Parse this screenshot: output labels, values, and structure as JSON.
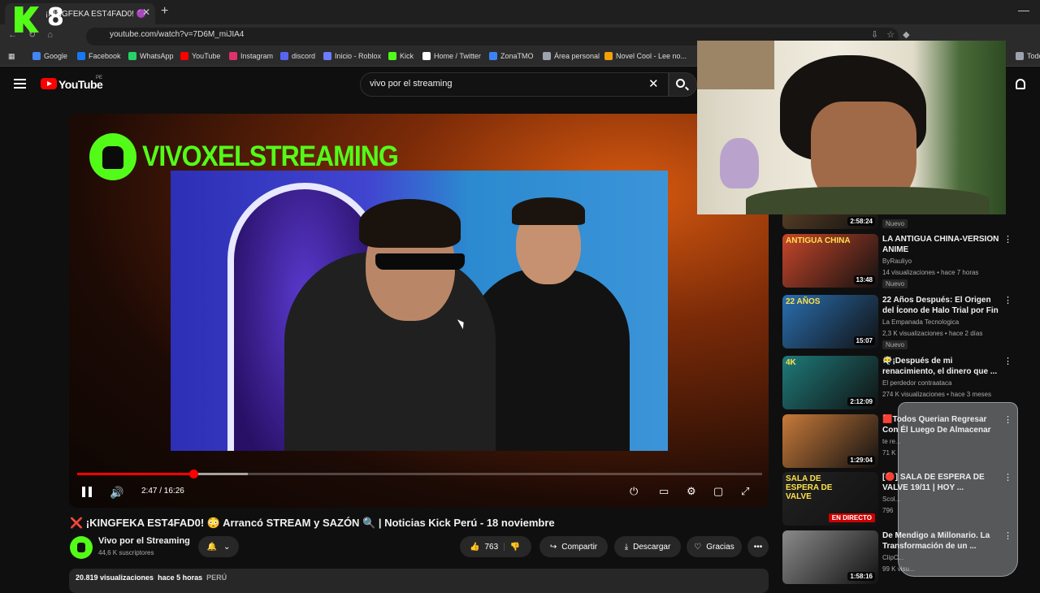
{
  "browser": {
    "tab_title": "¡KINGFEKA EST4FAD0! 🟣",
    "url": "youtube.com/watch?v=7D6M_miJIA4",
    "new_tab": "+",
    "tab_close": "✕",
    "minimize": "—",
    "kick_overlay": "8",
    "bookmarks": [
      {
        "label": "Google",
        "color": "#4285f4"
      },
      {
        "label": "Facebook",
        "color": "#1877f2"
      },
      {
        "label": "WhatsApp",
        "color": "#25d366"
      },
      {
        "label": "YouTube",
        "color": "#ff0000"
      },
      {
        "label": "Instagram",
        "color": "#e1306c"
      },
      {
        "label": "discord",
        "color": "#5865f2"
      },
      {
        "label": "Inicio - Roblox",
        "color": "#6b7cff"
      },
      {
        "label": "Kick",
        "color": "#53fc18"
      },
      {
        "label": "Home / Twitter",
        "color": "#ffffff"
      },
      {
        "label": "ZonaTMO",
        "color": "#3b82f6"
      },
      {
        "label": "Área personal",
        "color": "#9ca3af"
      },
      {
        "label": "Novel Cool - Lee no...",
        "color": "#f59e0b"
      },
      {
        "label": "Todos los",
        "color": "#9ca3af"
      }
    ]
  },
  "youtube": {
    "logo_text": "YouTube",
    "country": "PE",
    "search_query": "vivo por el streaming",
    "clear": "✕"
  },
  "player": {
    "brand": "VIVOXELSTREAMING",
    "time": "2:47 / 16:26",
    "progress_fraction": 0.17,
    "volume_icon": "🔊"
  },
  "video": {
    "title": "❌ ¡KINGFEKA EST4FAD0! 😳 Arrancó STREAM y SAZÓN 🔍 | Noticias Kick Perú - 18 noviembre",
    "channel": "Vivo por el Streaming",
    "subscribers": "44,6 K suscriptores",
    "likes": "763",
    "share": "Compartir",
    "download": "Descargar",
    "thanks": "Gracias",
    "more": "•••",
    "views": "20.819 visualizaciones",
    "age": "hace 5 horas",
    "location": "PERÚ"
  },
  "recommendations": [
    {
      "title": "",
      "channel": "",
      "meta": "",
      "badge": "Nuevo",
      "duration": "2:58:24",
      "thumb": "#6a4a2a"
    },
    {
      "title": "LA ANTIGUA CHINA-VERSION ANIME",
      "channel": "ByRauliyo",
      "meta": "14 visualizaciones • hace 7 horas",
      "badge": "Nuevo",
      "duration": "13:48",
      "thumb": "#c8462a",
      "thumb_text": "ANTIGUA CHINA"
    },
    {
      "title": "22 Años Después: El Origen del Ícono de Halo Trial por Fin ...",
      "channel": "La Empanada Tecnologica",
      "meta": "2,3 K visualizaciones • hace 2 días",
      "badge": "Nuevo",
      "duration": "15:07",
      "thumb": "#2a6fb0",
      "thumb_text": "22 AÑOS"
    },
    {
      "title": "😶‍🌫️¡Después de mi renacimiento, el dinero que ...",
      "channel": "El perdedor contraataca",
      "meta": "274 K visualizaciones • hace 3 meses",
      "badge": "",
      "duration": "2:12:09",
      "thumb": "#1e7a7a",
      "thumb_text": "4K"
    },
    {
      "title": "🟥Todos Querian Regresar Con Él Luego De Almacenar Mas D...",
      "channel": "te re...",
      "meta": "71 K",
      "badge": "",
      "duration": "1:29:04",
      "thumb": "#c87a3a",
      "thumb_text": ""
    },
    {
      "title": "[🔴] SALA DE ESPERA DE VALVE 19/11 | HOY ...",
      "channel": "Scol...",
      "meta": "796",
      "badge": "",
      "live": "EN DIRECTO",
      "thumb": "#222222",
      "thumb_text": "SALA DE ESPERA DE VALVE"
    },
    {
      "title": "De Mendigo a Millonario. La Transformación de un ...",
      "channel": "ClipC...",
      "meta": "99 K visu...",
      "badge": "",
      "duration": "1:58:16",
      "thumb": "#8a8a8a",
      "thumb_text": ""
    }
  ]
}
